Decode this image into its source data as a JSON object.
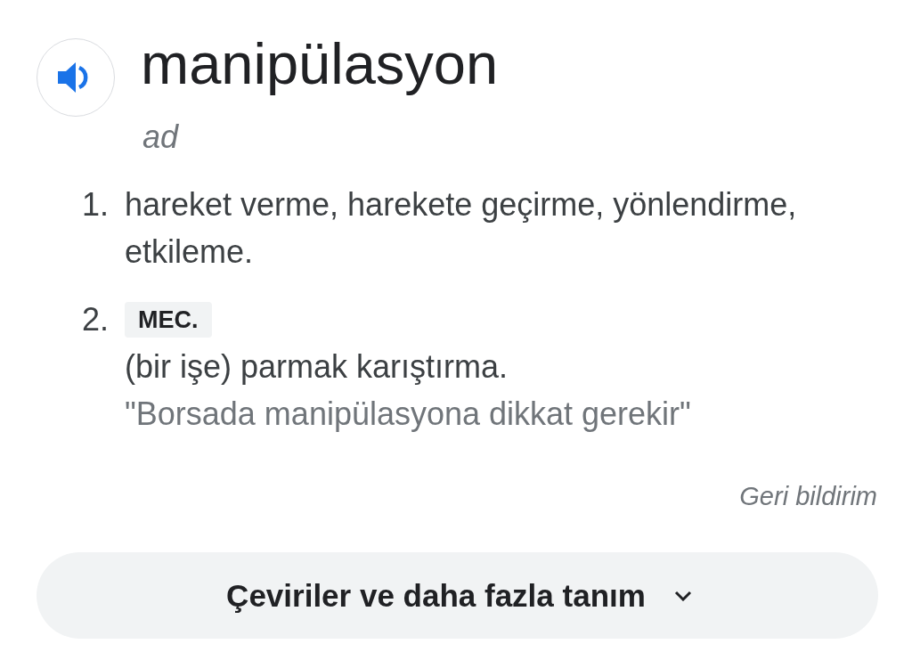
{
  "entry": {
    "headword": "manipülasyon",
    "part_of_speech": "ad"
  },
  "definitions": [
    {
      "number": "1.",
      "text": "hareket verme, harekete geçirme, yönlendirme, etkileme."
    },
    {
      "number": "2.",
      "label": "MEC.",
      "text": "(bir işe) parmak karıştırma.",
      "example": "\"Borsada manipülasyona dikkat gerekir\""
    }
  ],
  "feedback_link": "Geri bildirim",
  "more_button": {
    "label": "Çeviriler ve daha fazla tanım"
  }
}
